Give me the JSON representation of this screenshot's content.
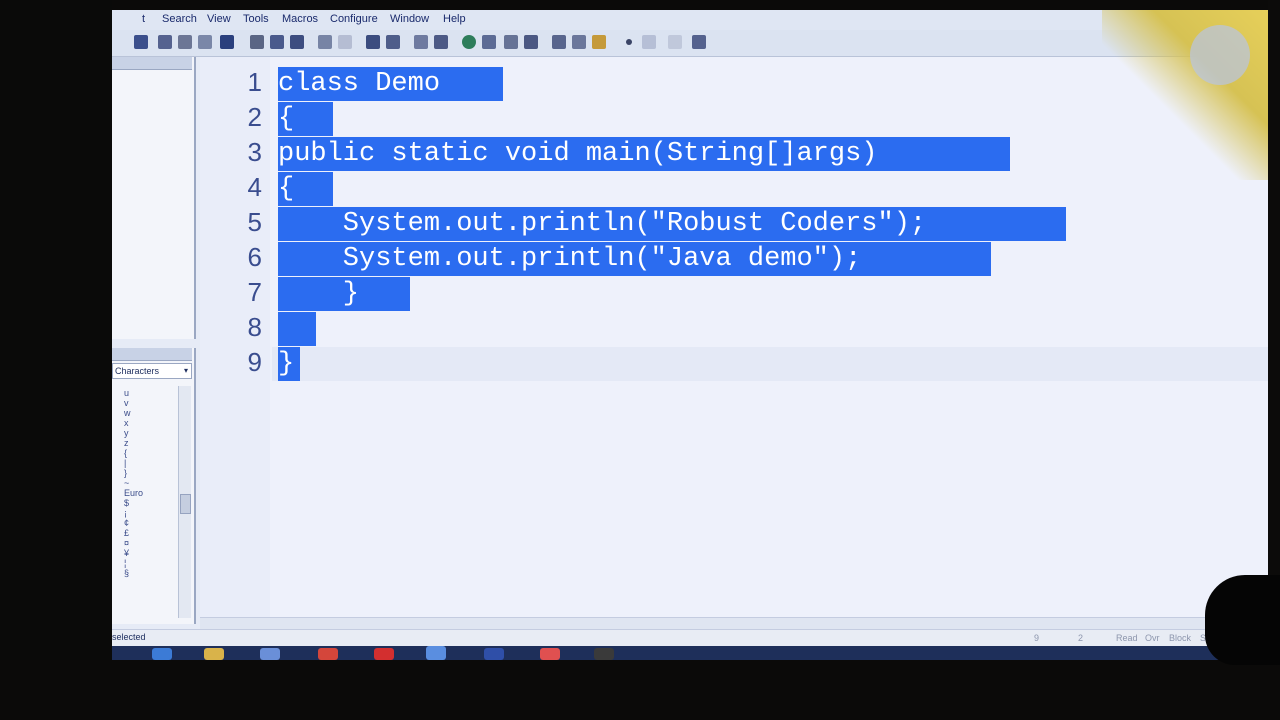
{
  "menu": [
    "t",
    "Search",
    "View",
    "Tools",
    "Macros",
    "Configure",
    "Window",
    "Help"
  ],
  "panels": {
    "characters_label": "Characters",
    "characters": [
      "u",
      "v",
      "w",
      "x",
      "y",
      "z",
      "{",
      "|",
      "}",
      "~",
      "Euro",
      "$",
      "",
      "",
      "¡",
      "¢",
      "£",
      "¤",
      "¥",
      "¦",
      "§"
    ]
  },
  "editor": {
    "line_numbers": [
      "1",
      "2",
      "3",
      "4",
      "5",
      "6",
      "7",
      "8",
      "9"
    ],
    "lines": [
      "class Demo ",
      "{",
      "public static void main(String[]args) ",
      "{",
      "    System.out.println(\"Robust Coders\"); ",
      "    System.out.println(\"Java demo\"); ",
      "    } ",
      " ",
      "}"
    ]
  },
  "status": {
    "left": "selected",
    "line": "9",
    "col": "2",
    "mode1": "Read",
    "mode2": "Ovr",
    "mode3": "Block",
    "mode4": "Sync"
  },
  "colors": {
    "selection": "#2b6cf0",
    "line_number": "#3a4d8f",
    "editor_bg": "#eef1fb"
  }
}
